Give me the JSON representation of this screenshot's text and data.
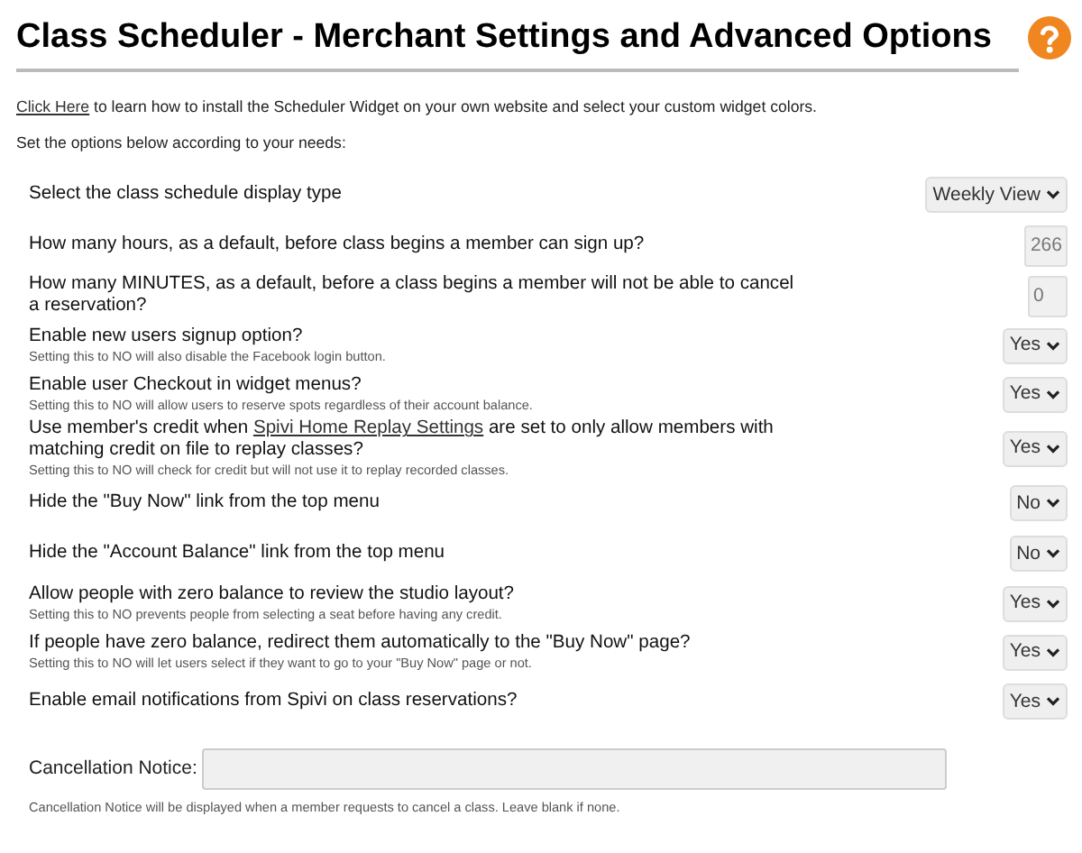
{
  "title": "Class Scheduler - Merchant Settings and Advanced Options",
  "intro": {
    "link": "Click Here",
    "text": "to learn how to install the Scheduler Widget on your own website and select your custom widget colors."
  },
  "instructions": "Set the options below according to your needs:",
  "settings": [
    {
      "kind": "select",
      "label": "Select the class schedule display type",
      "value": "Weekly View"
    },
    {
      "kind": "number",
      "label": "How many hours, as a default, before class begins a member can sign up?",
      "value": "266"
    },
    {
      "kind": "number",
      "label": "How many MINUTES, as a default, before a class begins a member will not be able to cancel a reservation?",
      "value": "0"
    },
    {
      "kind": "select",
      "label": "Enable new users signup option?",
      "note": "Setting this to NO will also disable the Facebook login button.",
      "value": "Yes"
    },
    {
      "kind": "select",
      "label": "Enable user Checkout in widget menus?",
      "note": "Setting this to NO will allow users to reserve spots regardless of their account balance.",
      "value": "Yes"
    },
    {
      "kind": "select",
      "label": "Use member's credit when",
      "link": "Spivi Home Replay Settings",
      "label_after": "are set to only allow members with matching credit on file to replay classes?",
      "note": "Setting this to NO will check for credit but will not use it to replay recorded classes.",
      "value": "Yes"
    },
    {
      "kind": "select",
      "label": "Hide the \"Buy Now\" link from the top menu",
      "value": "No"
    },
    {
      "kind": "select",
      "label": "Hide the \"Account Balance\" link from the top menu",
      "value": "No"
    },
    {
      "kind": "select",
      "label": "Allow people with zero balance to review the studio layout?",
      "note": "Setting this to NO prevents people from selecting a seat before having any credit.",
      "value": "Yes"
    },
    {
      "kind": "select",
      "label": "If people have zero balance, redirect them automatically to the \"Buy Now\" page?",
      "note": "Setting this to NO will let users select if they want to go to your \"Buy Now\" page or not.",
      "value": "Yes"
    },
    {
      "kind": "select",
      "label": "Enable email notifications from Spivi on class reservations?",
      "value": "Yes"
    }
  ],
  "cancellation": {
    "label": "Cancellation Notice:",
    "note": "Cancellation Notice will be displayed when a member requests to cancel a class. Leave blank if none."
  }
}
